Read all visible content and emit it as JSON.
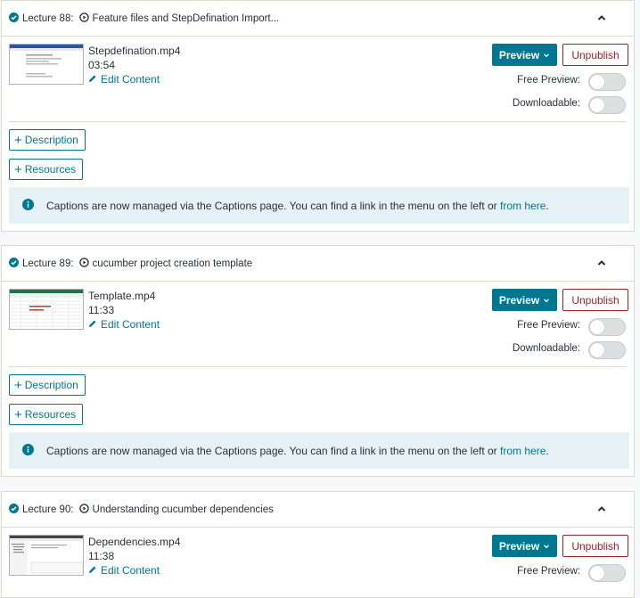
{
  "lectures": [
    {
      "number_label": "Lecture 88:",
      "title": "Feature files and StepDefination Import...",
      "file_name": "Stepdefination.mp4",
      "duration": "03:54",
      "edit_label": "Edit Content",
      "preview_label": "Preview",
      "unpublish_label": "Unpublish",
      "free_preview_label": "Free Preview:",
      "free_preview_on": false,
      "downloadable_label": "Downloadable:",
      "downloadable_on": false,
      "description_label": "Description",
      "resources_label": "Resources",
      "captions_text": "Captions are now managed via the Captions page. You can find a link in the menu on the left or",
      "captions_link": "from here",
      "captions_end": "."
    },
    {
      "number_label": "Lecture 89:",
      "title": "cucumber project creation template",
      "file_name": "Template.mp4",
      "duration": "11:33",
      "edit_label": "Edit Content",
      "preview_label": "Preview",
      "unpublish_label": "Unpublish",
      "free_preview_label": "Free Preview:",
      "free_preview_on": false,
      "downloadable_label": "Downloadable:",
      "downloadable_on": false,
      "description_label": "Description",
      "resources_label": "Resources",
      "captions_text": "Captions are now managed via the Captions page. You can find a link in the menu on the left or",
      "captions_link": "from here",
      "captions_end": "."
    },
    {
      "number_label": "Lecture 90:",
      "title": "Understanding cucumber dependencies",
      "file_name": "Dependencies.mp4",
      "duration": "11:38",
      "edit_label": "Edit Content",
      "preview_label": "Preview",
      "unpublish_label": "Unpublish",
      "free_preview_label": "Free Preview:",
      "free_preview_on": false
    }
  ],
  "colors": {
    "accent": "#007791",
    "danger": "#a11d2b",
    "info_bg": "#e6f1f5"
  },
  "icons": {
    "complete": "check-circle-icon",
    "media": "play-circle-icon",
    "collapse": "chevron-up-icon",
    "edit": "pencil-icon",
    "dropdown": "chevron-down-icon",
    "add": "plus-icon",
    "info": "info-circle-icon"
  }
}
